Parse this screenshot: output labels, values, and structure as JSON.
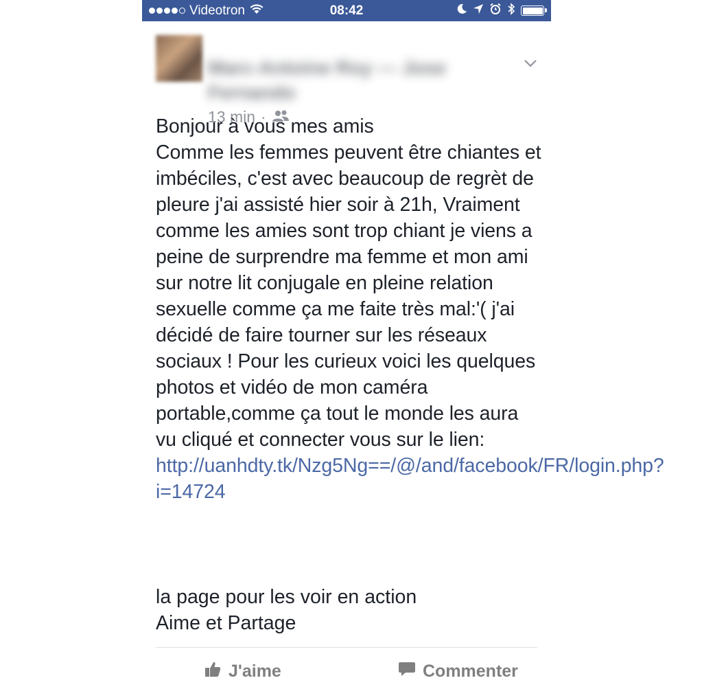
{
  "status_bar": {
    "carrier": "Videotron",
    "time": "08:42",
    "background": "#3b5998"
  },
  "post": {
    "author": "Marc-Antoine Roy — Jose Fernando",
    "timestamp": "13 min",
    "separator": "·",
    "audience_icon": "friends-icon",
    "body_lines": "Bonjour à vous mes amis\nComme les femmes peuvent être chiantes et imbéciles, c'est avec beaucoup de regrèt de pleure j'ai assisté hier soir à 21h, Vraiment comme les amies sont trop chiant je viens a peine de surprendre ma femme et mon ami sur notre lit conjugale en pleine relation sexuelle comme ça me faite très mal:'( j'ai décidé de faire tourner sur les réseaux sociaux ! Pour les curieux voici les quelques photos et vidéo de mon caméra portable,comme ça tout le monde les aura vu cliqué et connecter vous sur le lien: ",
    "link": "http://uanhdty.tk/Nzg5Ng==/@/and/facebook/FR/login.php?i=14724",
    "link_color": "#4b68a6",
    "footer_line1": "la page pour les voir en action",
    "footer_line2": "Aime et Partage"
  },
  "actions": {
    "like_label": "J'aime",
    "comment_label": "Commenter"
  }
}
